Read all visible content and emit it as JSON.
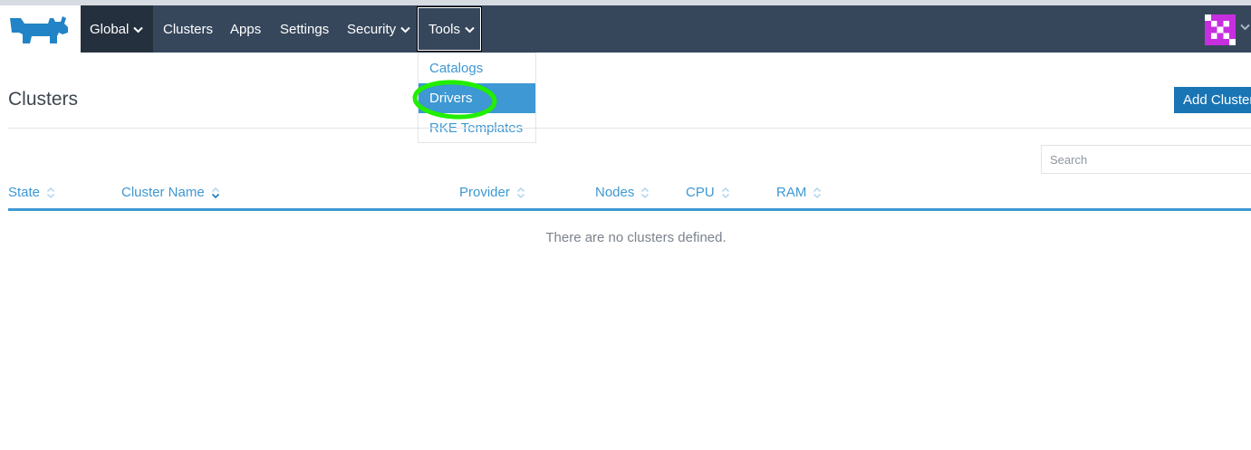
{
  "nav": {
    "global_label": "Global",
    "items": [
      "Clusters",
      "Apps",
      "Settings",
      "Security",
      "Tools"
    ]
  },
  "tools_menu": {
    "items": [
      "Catalogs",
      "Drivers",
      "RKE Templates"
    ],
    "active": "Drivers"
  },
  "page": {
    "title": "Clusters",
    "add_button": "Add Cluster",
    "search_placeholder": "Search"
  },
  "table": {
    "columns": [
      "State",
      "Cluster Name",
      "Provider",
      "Nodes",
      "CPU",
      "RAM"
    ],
    "empty_message": "There are no clusters defined."
  },
  "colors": {
    "nav_bg": "#36475c",
    "accent": "#3d98d3",
    "annotation": "#22ee00"
  },
  "icons": [
    "rancher-logo-icon",
    "chevron-down-icon",
    "sort-icon",
    "user-avatar-icon"
  ]
}
